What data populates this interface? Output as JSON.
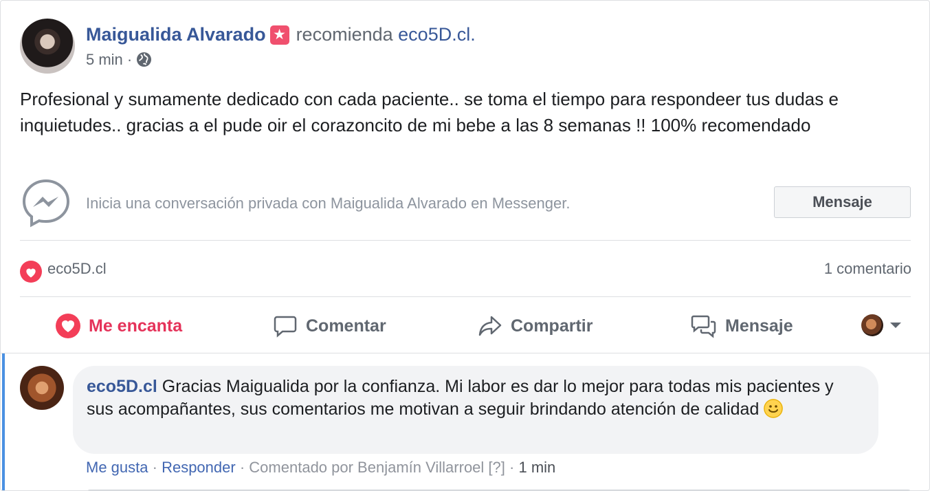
{
  "post": {
    "author": "Maigualida Alvarado",
    "badge_icon": "star-icon",
    "recommends_prefix": "recomienda",
    "recommended_page": "eco5D.cl.",
    "time": "5 min",
    "separator": "·",
    "privacy_icon": "globe-icon",
    "text": "Profesional y sumamente dedicado con cada paciente.. se toma el tiempo para respondeer tus dudas e inquietudes.. gracias a el pude oir el corazoncito de mi bebe a las 8 semanas !! 100% recomendado"
  },
  "messenger": {
    "prompt": "Inicia una conversación privada con Maigualida Alvarado en Messenger.",
    "button_label": "Mensaje"
  },
  "reactions": {
    "page_name": "eco5D.cl",
    "comment_count": "1 comentario"
  },
  "actions": {
    "love": "Me encanta",
    "comment": "Comentar",
    "share": "Compartir",
    "message": "Mensaje"
  },
  "comment": {
    "author": "eco5D.cl",
    "text": "Gracias Maigualida por la confianza. Mi labor es dar lo mejor para todas mis pacientes y sus acompañantes, sus comentarios me motivan a seguir brindando atención de calidad",
    "emoji": "slightly-smiling-face-icon",
    "like": "Me gusta",
    "reply": "Responder",
    "sep": "·",
    "commented_by": "Comentado por Benjamín Villarroel",
    "help": "[?]",
    "time": "1 min"
  },
  "colors": {
    "link": "#385898",
    "love": "#e5335a",
    "heart": "#f33e58",
    "accent_bar": "#4a90e2"
  }
}
